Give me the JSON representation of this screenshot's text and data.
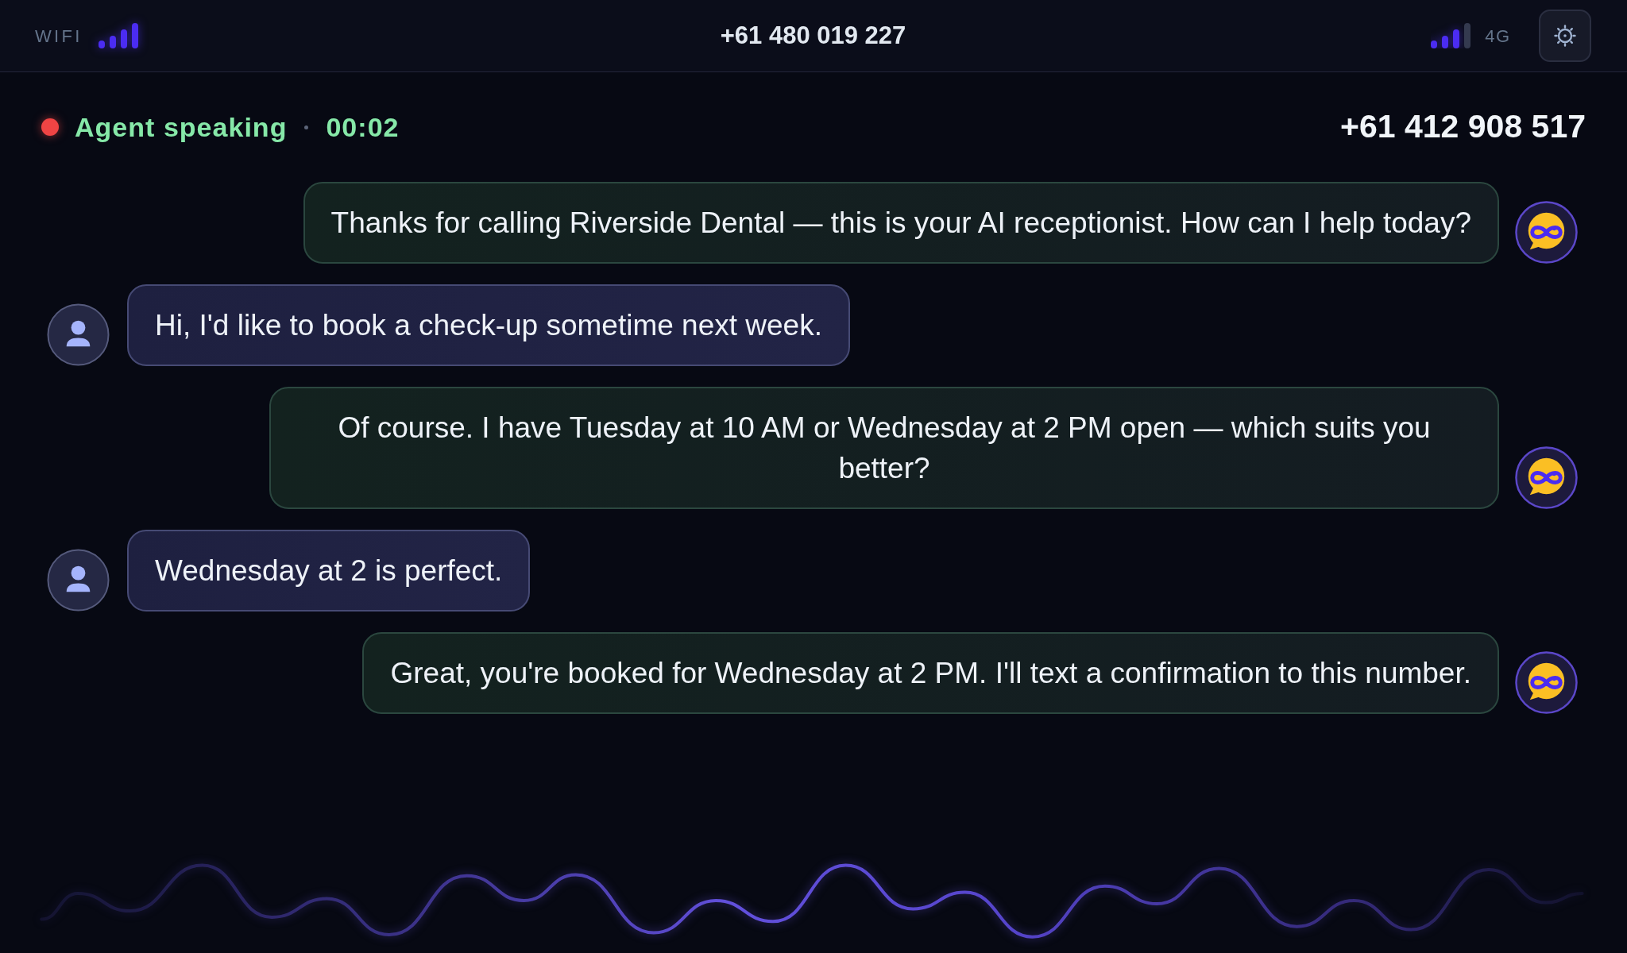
{
  "status_bar": {
    "wifi_label": "WIFI",
    "phone_number": "+61 480 019 227",
    "network_label": "4G"
  },
  "call": {
    "status": "Agent speaking",
    "timer": "00:02",
    "caller_number": "+61 412 908 517"
  },
  "messages": [
    {
      "kind": "agent",
      "text": "Thanks for calling Riverside Dental — this is your AI receptionist. How can I help today?"
    },
    {
      "kind": "caller",
      "text": "Hi, I'd like to book a check-up sometime next week."
    },
    {
      "kind": "agent",
      "text": "Of course. I have Tuesday at 10 AM or Wednesday at 2 PM open — which suits you better?"
    },
    {
      "kind": "caller",
      "text": "Wednesday at 2 is perfect."
    },
    {
      "kind": "agent",
      "text": "Great, you're booked for Wednesday at 2 PM. I'll text a confirmation to this number."
    }
  ]
}
